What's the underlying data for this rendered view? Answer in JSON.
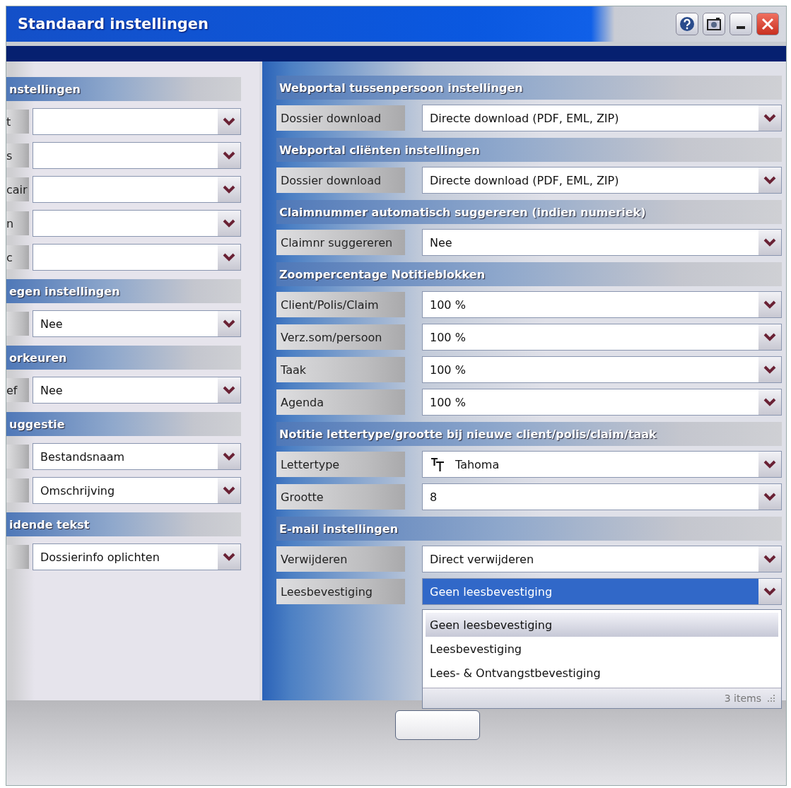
{
  "window": {
    "title": "Standaard instellingen"
  },
  "left_panel": {
    "sections": [
      {
        "title": "nstellingen",
        "rows": [
          {
            "label": "t",
            "value": "",
            "kind": "select",
            "open": false
          },
          {
            "label": "s",
            "value": "",
            "kind": "select",
            "open": false
          },
          {
            "label": "cair",
            "value": "",
            "kind": "select",
            "open": false
          },
          {
            "label": "n",
            "value": "",
            "kind": "select",
            "open": false
          },
          {
            "label": "c",
            "value": "",
            "kind": "select",
            "open": false
          }
        ]
      },
      {
        "title": "egen instellingen",
        "rows": [
          {
            "label": "",
            "value": "Nee",
            "kind": "select",
            "open": false
          }
        ]
      },
      {
        "title": "orkeuren",
        "rows": [
          {
            "label": "ef",
            "value": "Nee",
            "kind": "select",
            "open": false
          }
        ]
      },
      {
        "title": "uggestie",
        "rows": [
          {
            "label": "",
            "value": "Bestandsnaam",
            "kind": "select",
            "open": false
          },
          {
            "label": "",
            "value": "Omschrijving",
            "kind": "select",
            "open": false
          }
        ]
      },
      {
        "title": "idende tekst",
        "rows": [
          {
            "label": "",
            "value": "Dossierinfo oplichten",
            "kind": "select",
            "open": false
          }
        ]
      }
    ]
  },
  "right_panel": {
    "sections": [
      {
        "title": "Webportal tussenpersoon instellingen",
        "rows": [
          {
            "label": "Dossier download",
            "value": "Directe download (PDF, EML, ZIP)",
            "kind": "select",
            "open": false
          }
        ]
      },
      {
        "title": "Webportal cliënten instellingen",
        "rows": [
          {
            "label": "Dossier download",
            "value": "Directe download (PDF, EML, ZIP)",
            "kind": "select",
            "open": false
          }
        ]
      },
      {
        "title": "Claimnummer automatisch suggereren (indien numeriek)",
        "rows": [
          {
            "label": "Claimnr suggereren",
            "value": "Nee",
            "kind": "select",
            "open": false
          }
        ]
      },
      {
        "title": "Zoompercentage Notitieblokken",
        "rows": [
          {
            "label": "Client/Polis/Claim",
            "value": "100 %",
            "kind": "select",
            "open": false
          },
          {
            "label": "Verz.som/persoon",
            "value": "100 %",
            "kind": "select",
            "open": false
          },
          {
            "label": "Taak",
            "value": "100 %",
            "kind": "select",
            "open": false
          },
          {
            "label": "Agenda",
            "value": "100 %",
            "kind": "select",
            "open": false
          }
        ]
      },
      {
        "title": "Notitie lettertype/grootte bij nieuwe client/polis/claim/taak",
        "rows": [
          {
            "label": "Lettertype",
            "value": "Tahoma",
            "kind": "font",
            "open": false
          },
          {
            "label": "Grootte",
            "value": "8",
            "kind": "select",
            "open": false
          }
        ]
      },
      {
        "title": "E-mail instellingen",
        "rows": [
          {
            "label": "Verwijderen",
            "value": "Direct verwijderen",
            "kind": "select",
            "open": false
          },
          {
            "label": "Leesbevestiging",
            "value": "Geen leesbevestiging",
            "kind": "select",
            "open": true,
            "options": [
              {
                "label": "Geen leesbevestiging",
                "selected": true
              },
              {
                "label": "Leesbevestiging",
                "selected": false
              },
              {
                "label": "Lees- & Ontvangstbevestiging",
                "selected": false
              }
            ],
            "footer": "3 items"
          }
        ]
      }
    ]
  }
}
